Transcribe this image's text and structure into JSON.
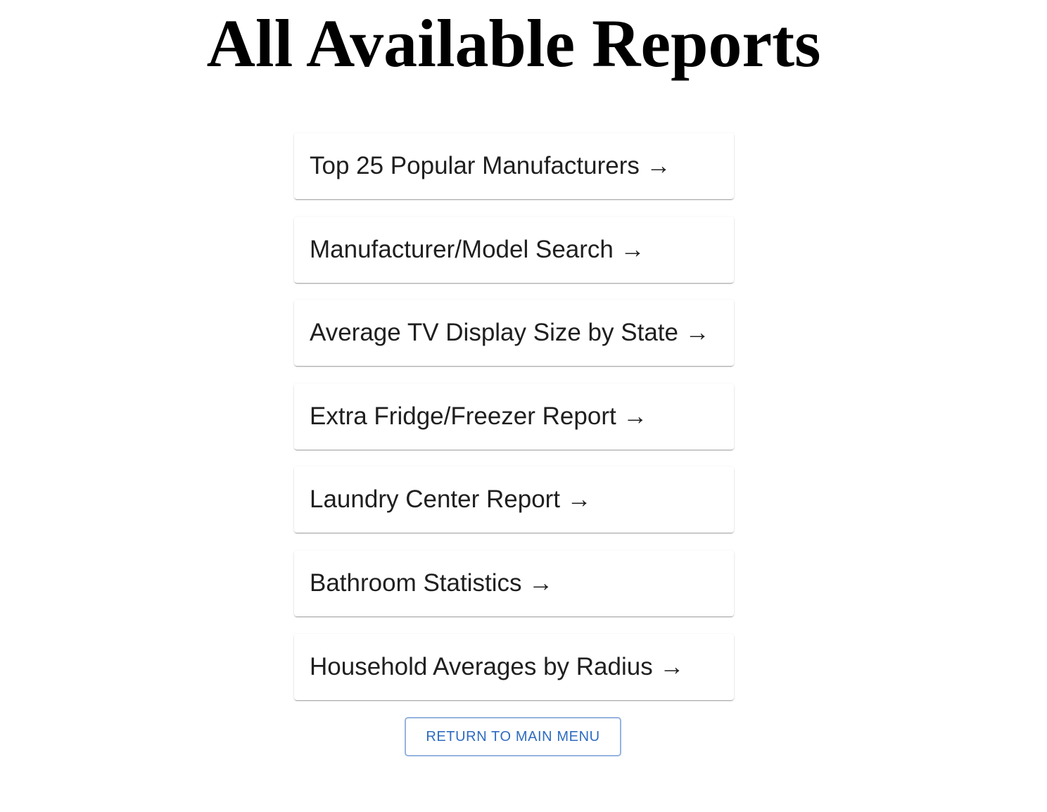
{
  "header": {
    "title": "All Available Reports"
  },
  "reports": [
    {
      "label": "Top 25 Popular Manufacturers →"
    },
    {
      "label": "Manufacturer/Model Search →"
    },
    {
      "label": "Average TV Display Size by State →"
    },
    {
      "label": "Extra Fridge/Freezer Report →"
    },
    {
      "label": "Laundry Center Report →"
    },
    {
      "label": "Bathroom Statistics →"
    },
    {
      "label": "Household Averages by Radius →"
    }
  ],
  "footer": {
    "return_label": "RETURN TO MAIN MENU"
  },
  "colors": {
    "title_text": "#000000",
    "card_text": "#1f1f1f",
    "button_text": "#2e6bc0",
    "button_border": "#95b3df"
  }
}
